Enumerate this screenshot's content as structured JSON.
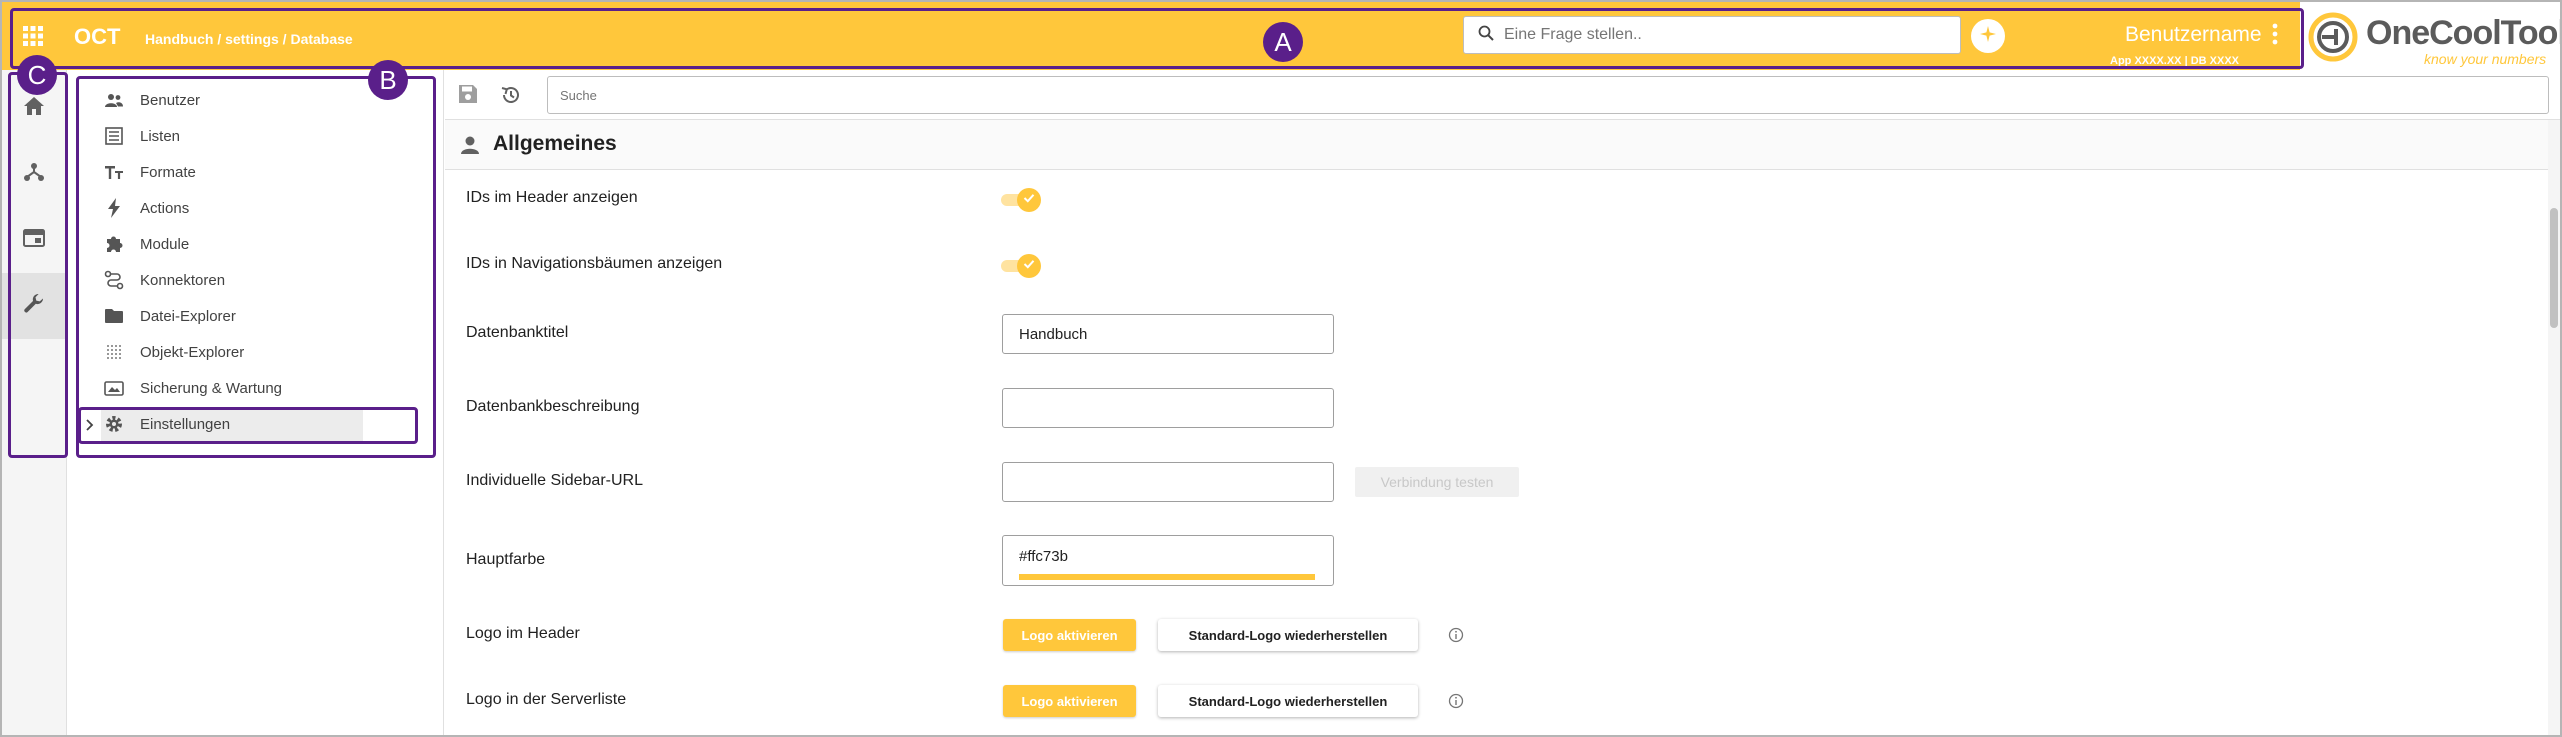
{
  "header": {
    "brand": "OCT",
    "breadcrumb": "Handbuch / settings / Database",
    "ask_placeholder": "Eine Frage stellen..",
    "username": "Benutzername",
    "meta": "App XXXX.XX | DB XXXX",
    "logo_text": "OneCoolTool",
    "logo_tagline": "know your numbers",
    "accent_color": "#ffc73b"
  },
  "rail": {
    "items": [
      {
        "icon": "home-icon"
      },
      {
        "icon": "hierarchy-icon"
      },
      {
        "icon": "window-icon"
      },
      {
        "icon": "wrench-icon",
        "active": true
      }
    ]
  },
  "nav": {
    "items": [
      {
        "label": "Benutzer",
        "icon": "users-icon"
      },
      {
        "label": "Listen",
        "icon": "list-icon"
      },
      {
        "label": "Formate",
        "icon": "text-format-icon"
      },
      {
        "label": "Actions",
        "icon": "bolt-icon"
      },
      {
        "label": "Module",
        "icon": "puzzle-icon"
      },
      {
        "label": "Konnektoren",
        "icon": "connector-icon"
      },
      {
        "label": "Datei-Explorer",
        "icon": "folder-icon"
      },
      {
        "label": "Objekt-Explorer",
        "icon": "grid-dots-icon"
      },
      {
        "label": "Sicherung & Wartung",
        "icon": "backup-icon"
      },
      {
        "label": "Einstellungen",
        "icon": "gear-icon",
        "selected": true
      }
    ]
  },
  "toolbar": {
    "search_placeholder": "Suche"
  },
  "section": {
    "title": "Allgemeines"
  },
  "settings": {
    "ids_header_label": "IDs im Header anzeigen",
    "ids_header_on": true,
    "ids_nav_label": "IDs in Navigationsbäumen anzeigen",
    "ids_nav_on": true,
    "db_title_label": "Datenbanktitel",
    "db_title_value": "Handbuch",
    "db_desc_label": "Datenbankbeschreibung",
    "db_desc_value": "",
    "sidebar_url_label": "Individuelle Sidebar-URL",
    "sidebar_url_value": "",
    "test_connection_label": "Verbindung testen",
    "main_color_label": "Hauptfarbe",
    "main_color_value": "#ffc73b",
    "logo_header_label": "Logo im Header",
    "logo_serverlist_label": "Logo in der Serverliste",
    "activate_logo_label": "Logo aktivieren",
    "restore_logo_label": "Standard-Logo wiederherstellen"
  },
  "annotations": {
    "a": "A",
    "b": "B",
    "c": "C"
  }
}
